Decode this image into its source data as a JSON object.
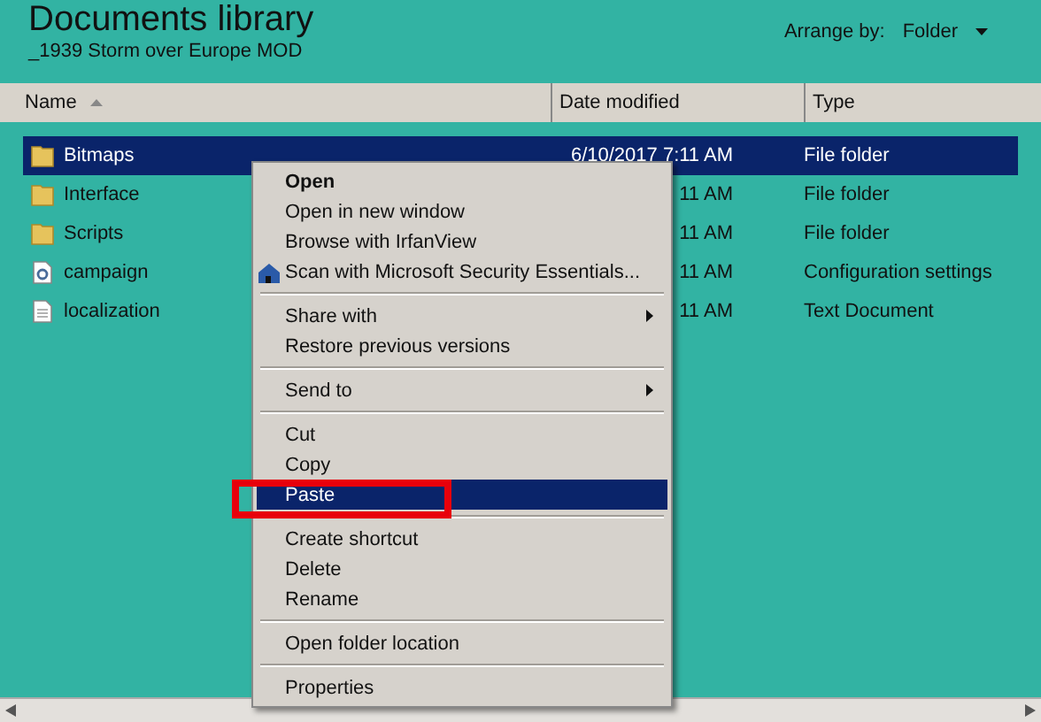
{
  "header": {
    "title": "Documents library",
    "subtitle": "_1939 Storm over Europe MOD",
    "arrange_label": "Arrange by:",
    "arrange_value": "Folder"
  },
  "columns": [
    {
      "label": "Name",
      "sorted": true
    },
    {
      "label": "Date modified",
      "sorted": false
    },
    {
      "label": "Type",
      "sorted": false
    }
  ],
  "rows": [
    {
      "name": "Bitmaps",
      "date": "6/10/2017 7:11 AM",
      "type": "File folder",
      "kind": "folder",
      "selected": true
    },
    {
      "name": "Interface",
      "date": "11 AM",
      "type": "File folder",
      "kind": "folder",
      "selected": false
    },
    {
      "name": "Scripts",
      "date": "11 AM",
      "type": "File folder",
      "kind": "folder",
      "selected": false
    },
    {
      "name": "campaign",
      "date": "11 AM",
      "type": "Configuration settings",
      "kind": "settings",
      "selected": false
    },
    {
      "name": "localization",
      "date": "11 AM",
      "type": "Text Document",
      "kind": "text",
      "selected": false
    }
  ],
  "context_menu": [
    {
      "kind": "item",
      "label": "Open",
      "bold": true,
      "selected": false
    },
    {
      "kind": "item",
      "label": "Open in new window",
      "selected": false
    },
    {
      "kind": "item",
      "label": "Browse with IrfanView",
      "selected": false
    },
    {
      "kind": "item",
      "label": "Scan with Microsoft Security Essentials...",
      "icon": true,
      "selected": false
    },
    {
      "kind": "separator"
    },
    {
      "kind": "item",
      "label": "Share with",
      "submenu": true,
      "selected": false
    },
    {
      "kind": "item",
      "label": "Restore previous versions",
      "selected": false
    },
    {
      "kind": "separator"
    },
    {
      "kind": "item",
      "label": "Send to",
      "submenu": true,
      "selected": false
    },
    {
      "kind": "separator"
    },
    {
      "kind": "item",
      "label": "Cut",
      "selected": false
    },
    {
      "kind": "item",
      "label": "Copy",
      "selected": false
    },
    {
      "kind": "item",
      "label": "Paste",
      "selected": true,
      "highlighted": true
    },
    {
      "kind": "separator"
    },
    {
      "kind": "item",
      "label": "Create shortcut",
      "selected": false
    },
    {
      "kind": "item",
      "label": "Delete",
      "selected": false
    },
    {
      "kind": "item",
      "label": "Rename",
      "selected": false
    },
    {
      "kind": "separator"
    },
    {
      "kind": "item",
      "label": "Open folder location",
      "selected": false
    },
    {
      "kind": "separator"
    },
    {
      "kind": "item",
      "label": "Properties",
      "selected": false
    }
  ]
}
